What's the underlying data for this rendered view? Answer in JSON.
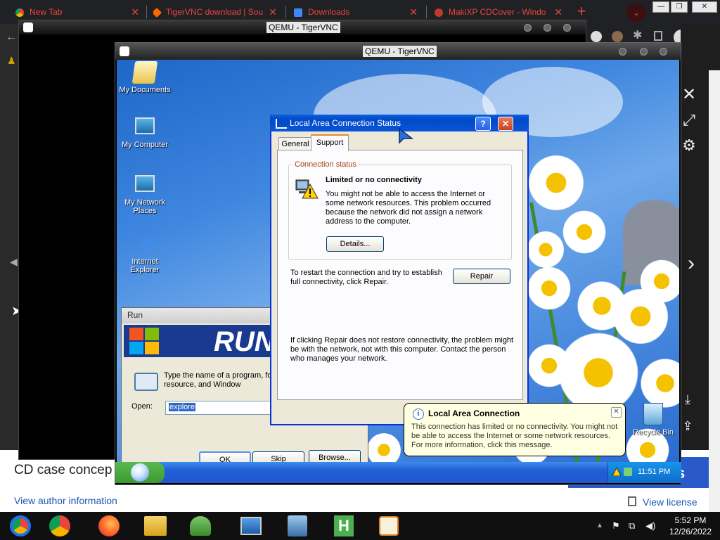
{
  "browser": {
    "tabs": [
      {
        "label": "New Tab",
        "icon": "chrome-icon"
      },
      {
        "label": "TigerVNC download | Sou",
        "icon": "sourceforge-icon"
      },
      {
        "label": "Downloads",
        "icon": "download-icon"
      },
      {
        "label": "MakiXP CDCover - Windo",
        "icon": "deviantart-icon"
      }
    ],
    "new_tab": "+",
    "window_controls": [
      "—",
      "❐",
      "✕"
    ]
  },
  "vnc_outer": {
    "title": "QEMU - TigerVNC"
  },
  "vnc_inner": {
    "title": "QEMU - TigerVNC"
  },
  "desktop_icons": [
    {
      "label": "My Documents"
    },
    {
      "label": "My Computer"
    },
    {
      "label": "My Network Places"
    },
    {
      "label": "Internet Explorer"
    }
  ],
  "run_dialog": {
    "title": "Run",
    "banner": "RUN",
    "description": "Type the name of a program, fo Internet resource, and Window",
    "open_label": "Open:",
    "open_value": "explore",
    "ok": "OK",
    "skip": "Skip",
    "browse": "Browse..."
  },
  "lac_dialog": {
    "title": "Local Area Connection Status",
    "help_btn": "?",
    "close_btn": "✕",
    "tabs": [
      "General",
      "Support"
    ],
    "active_tab": "Support",
    "group_label": "Connection status",
    "status_heading": "Limited or no connectivity",
    "status_body": "You might not be able to access the Internet or some network resources. This problem occurred because the network did not assign a network address to the computer.",
    "details_btn": "Details...",
    "repair_text": "To restart the connection and try to establish full connectivity, click Repair.",
    "repair_btn": "Repair",
    "if_repair_text": "If clicking Repair does not restore connectivity, the problem might be with the network, not with this computer. Contact the person who manages your network."
  },
  "balloon": {
    "title": "Local Area Connection",
    "info_glyph": "i",
    "close_glyph": "✕",
    "body": "This connection has limited or no connectivity. You might not be able to access the Internet or some network resources. For more information, click this message."
  },
  "recycle_bin": {
    "label": "Recycle Bin"
  },
  "xp_taskbar": {
    "clock": "11:51 PM"
  },
  "page": {
    "cd_title": "CD case concep",
    "view_author": "View author information",
    "view_license": "View license",
    "button_partial": "s"
  },
  "host_taskbar": {
    "time": "5:52 PM",
    "date": "12/26/2022",
    "apps": [
      "chromium-icon",
      "chrome-icon",
      "firefox-icon",
      "file-manager-icon",
      "network-users-icon",
      "remote-desktop-icon",
      "vm-manager-icon",
      "h-app-icon",
      "tigervnc-icon"
    ]
  },
  "colors": {
    "tab_text": "#e8453c",
    "xp_title_blue": "#0a5fde",
    "link_blue": "#1a58b7"
  }
}
